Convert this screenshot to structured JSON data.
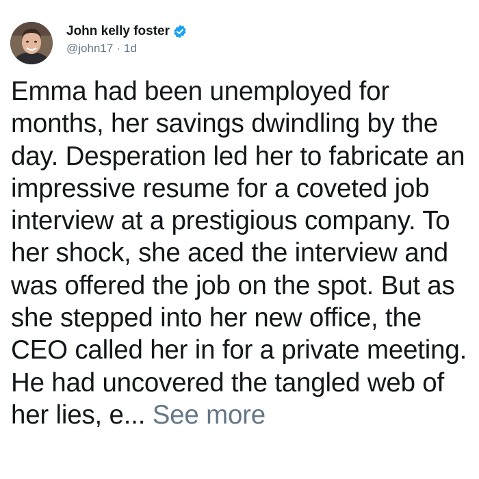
{
  "tweet": {
    "author": {
      "display_name": "John kelly foster",
      "handle": "@john17",
      "separator": "·",
      "age": "1d",
      "verified": true,
      "avatar_icon": "profile-photo",
      "verified_icon": "verified-badge-icon"
    },
    "text": "Emma had been unemployed for months, her savings dwindling by the day. Desperation led her to fabricate an impressive resume for a coveted job interview at a prestigious company. To her shock, she aced the interview and was offered the job on the spot. But as she stepped into her new office, the CEO called her in for a private meeting. He had uncovered the tangled web of her lies, e... ",
    "see_more_label": "See more"
  },
  "colors": {
    "text_primary": "#14171a",
    "text_secondary": "#657786",
    "verified_badge": "#1da1f2"
  }
}
